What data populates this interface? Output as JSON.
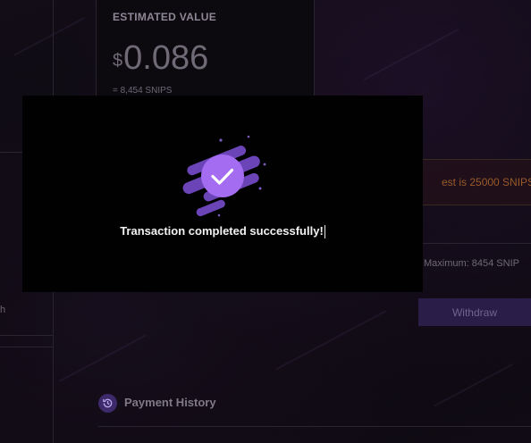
{
  "estimated_value": {
    "label": "ESTIMATED VALUE",
    "currency_symbol": "$",
    "amount": "0.086",
    "snips": "= 8,454 SNIPS"
  },
  "notice": {
    "text": "est is 25000 SNIPS",
    "color": "#9a5a2a"
  },
  "withdraw": {
    "maximum_text": "Maximum: 8454 SNIP",
    "button_label": "Withdraw",
    "button_color": "#2a1d48"
  },
  "left_fragment": "h",
  "payment_history": {
    "title": "Payment History",
    "icon": "history-icon"
  },
  "modal": {
    "message": "Transaction completed successfully!",
    "icon": "check-circle-icon",
    "accent_color": "#a46cf0"
  }
}
